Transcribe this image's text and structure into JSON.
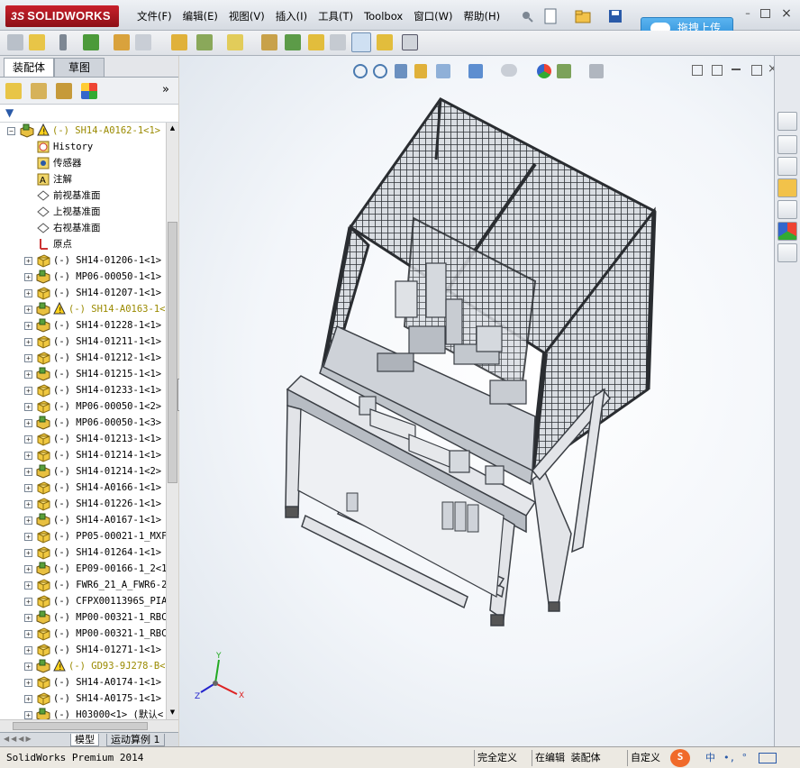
{
  "app": {
    "logo_prefix": "3S",
    "logo_text": "SOLIDWORKS"
  },
  "menu": [
    "文件(F)",
    "编辑(E)",
    "视图(V)",
    "插入(I)",
    "工具(T)",
    "Toolbox",
    "窗口(W)",
    "帮助(H)"
  ],
  "upload_button": "拖拽上传",
  "panel": {
    "tabs": [
      "装配体",
      "草图"
    ],
    "root": "(-) SH14-A0162-1<1>",
    "fixed_items": [
      "History",
      "传感器",
      "注解",
      "前视基准面",
      "上视基准面",
      "右视基准面",
      "原点"
    ],
    "components": [
      {
        "label": "(-) SH14-01206-1<1>",
        "warn": false
      },
      {
        "label": "(-) MP06-00050-1<1>",
        "warn": false
      },
      {
        "label": "(-) SH14-01207-1<1>",
        "warn": false
      },
      {
        "label": "(-) SH14-A0163-1<",
        "warn": true
      },
      {
        "label": "(-) SH14-01228-1<1>",
        "warn": false
      },
      {
        "label": "(-) SH14-01211-1<1>",
        "warn": false
      },
      {
        "label": "(-) SH14-01212-1<1>",
        "warn": false
      },
      {
        "label": "(-) SH14-01215-1<1>",
        "warn": false
      },
      {
        "label": "(-) SH14-01233-1<1>",
        "warn": false
      },
      {
        "label": "(-) MP06-00050-1<2>",
        "warn": false
      },
      {
        "label": "(-) MP06-00050-1<3>",
        "warn": false
      },
      {
        "label": "(-) SH14-01213-1<1>",
        "warn": false
      },
      {
        "label": "(-) SH14-01214-1<1>",
        "warn": false
      },
      {
        "label": "(-) SH14-01214-1<2>",
        "warn": false
      },
      {
        "label": "(-) SH14-A0166-1<1>",
        "warn": false
      },
      {
        "label": "(-) SH14-01226-1<1>",
        "warn": false
      },
      {
        "label": "(-) SH14-A0167-1<1>",
        "warn": false
      },
      {
        "label": "(-) PP05-00021-1_MXF",
        "warn": false
      },
      {
        "label": "(-) SH14-01264-1<1>",
        "warn": false
      },
      {
        "label": "(-) EP09-00166-1_2<1",
        "warn": false
      },
      {
        "label": "(-) FWR6_21_A_FWR6-2",
        "warn": false
      },
      {
        "label": "(-) CFPX0011396S_PIA",
        "warn": false
      },
      {
        "label": "(-) MP00-00321-1_RBC",
        "warn": false
      },
      {
        "label": "(-) MP00-00321-1_RBC",
        "warn": false
      },
      {
        "label": "(-) SH14-01271-1<1>",
        "warn": false
      },
      {
        "label": "(-) GD93-9J278-B<",
        "warn": true
      },
      {
        "label": "(-) SH14-A0174-1<1>",
        "warn": false
      },
      {
        "label": "(-) SH14-A0175-1<1>",
        "warn": false
      },
      {
        "label": "(-) H03000<1> (默认<",
        "warn": false
      }
    ],
    "bottom_tabs": [
      "模型",
      "运动算例 1"
    ]
  },
  "triad": {
    "x": "X",
    "y": "Y",
    "z": "Z"
  },
  "status": {
    "product": "SolidWorks Premium 2014",
    "state": "完全定义",
    "mode": "在编辑 装配体",
    "custom": "自定义"
  },
  "colors": {
    "warn_text": "#9a8a00",
    "accent": "#2f8fd8",
    "frame": "#3b3f45"
  }
}
